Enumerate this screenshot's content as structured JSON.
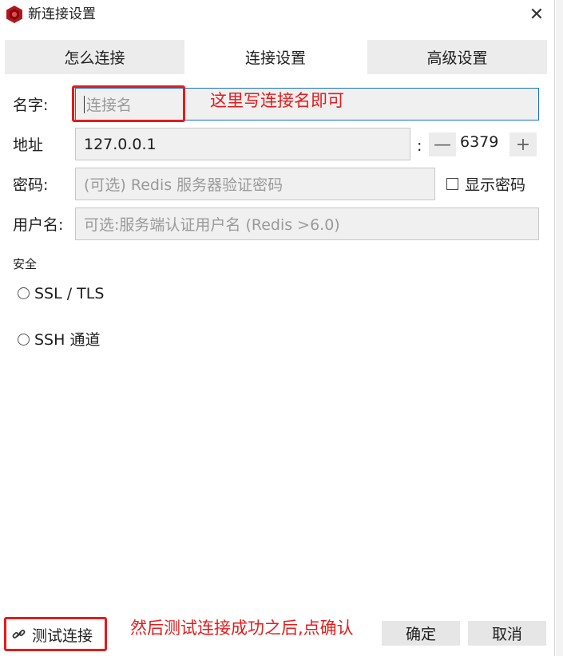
{
  "window": {
    "title": "新连接设置",
    "icons": {
      "app": "redis-app-icon",
      "close": "close-icon"
    }
  },
  "tabs": [
    {
      "label": "怎么连接",
      "active": false
    },
    {
      "label": "连接设置",
      "active": true
    },
    {
      "label": "高级设置",
      "active": false
    }
  ],
  "form": {
    "name": {
      "label": "名字:",
      "placeholder": "连接名",
      "value": ""
    },
    "address": {
      "label": "地址",
      "value": "127.0.0.1",
      "separator": ":"
    },
    "port": {
      "value": "6379",
      "decrement": "—",
      "increment": "+"
    },
    "password": {
      "label": "密码:",
      "placeholder": "(可选) Redis 服务器验证密码",
      "show_password_label": "显示密码",
      "show_password_checked": false
    },
    "username": {
      "label": "用户名:",
      "placeholder": "可选:服务端认证用户名 (Redis >6.0)"
    },
    "security": {
      "section_label": "安全",
      "options": [
        "SSL / TLS",
        "SSH 通道"
      ]
    }
  },
  "footer": {
    "test_label": "测试连接",
    "ok_label": "确定",
    "cancel_label": "取消",
    "test_icon": "link-icon"
  },
  "annotations": {
    "name_note": "这里写连接名即可",
    "test_note": "然后测试连接成功之后,点确认",
    "color": "#e21c1c"
  }
}
